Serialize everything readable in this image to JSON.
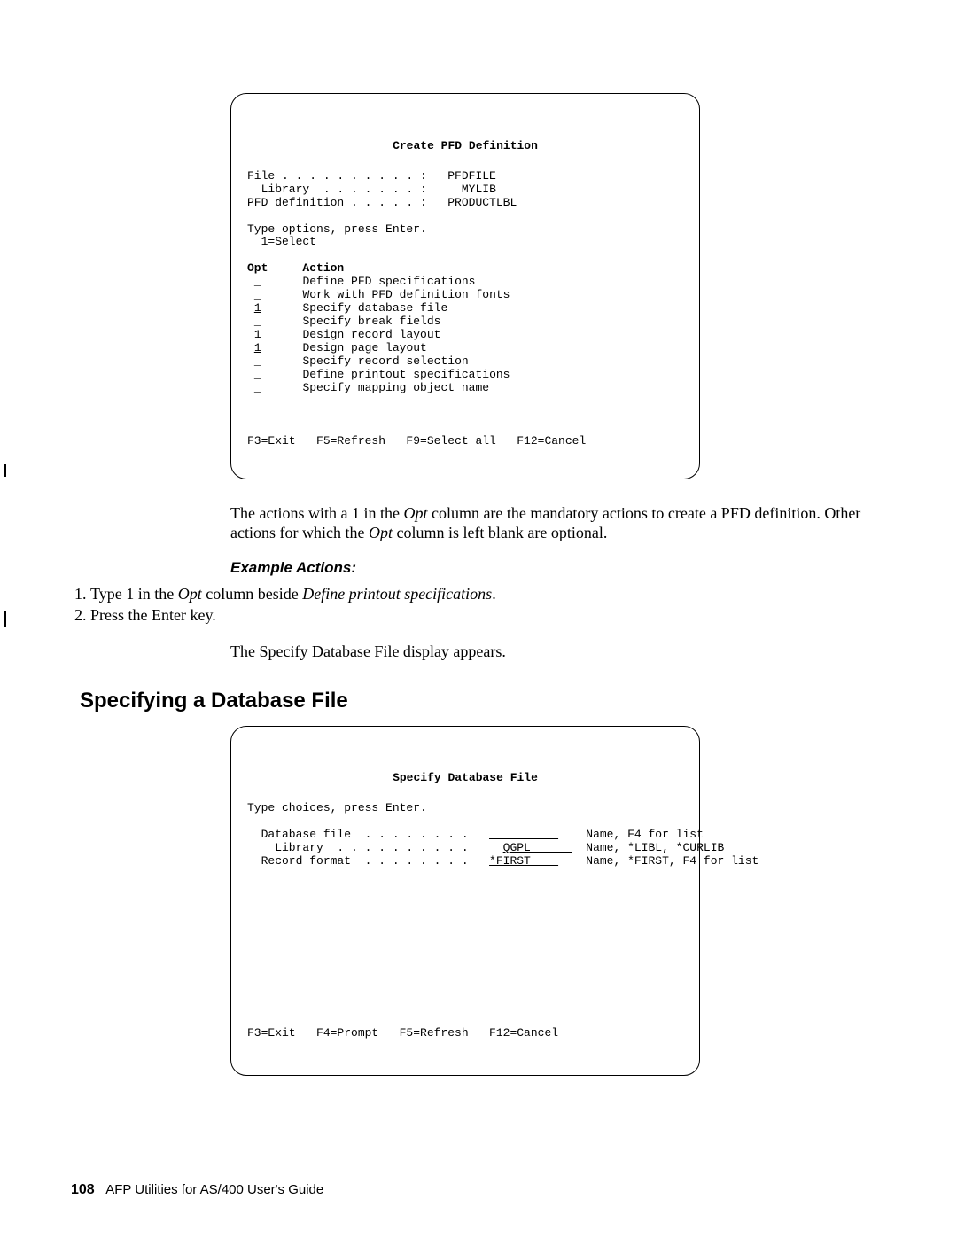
{
  "screen1": {
    "title": "Create PFD Definition",
    "fields": {
      "fileLabel": "File . . . . . . . . . . :",
      "fileValue": "PFDFILE",
      "libraryLabel": "  Library  . . . . . . . :",
      "libraryValue": "MYLIB",
      "pfdDefLabel": "PFD definition . . . . . :",
      "pfdDefValue": "PRODUCTLBL"
    },
    "instruction1": "Type options, press Enter.",
    "instruction2": "  1=Select",
    "cols": {
      "opt": "Opt",
      "action": "Action"
    },
    "rows": [
      {
        "opt": "_",
        "opt_u": false,
        "action": "Define PFD specifications"
      },
      {
        "opt": "_",
        "opt_u": false,
        "action": "Work with PFD definition fonts"
      },
      {
        "opt": "1",
        "opt_u": true,
        "action": "Specify database file"
      },
      {
        "opt": "_",
        "opt_u": false,
        "action": "Specify break fields"
      },
      {
        "opt": "1",
        "opt_u": true,
        "action": "Design record layout"
      },
      {
        "opt": "1",
        "opt_u": true,
        "action": "Design page layout"
      },
      {
        "opt": "_",
        "opt_u": false,
        "action": "Specify record selection"
      },
      {
        "opt": "_",
        "opt_u": false,
        "action": "Define printout specifications"
      },
      {
        "opt": "_",
        "opt_u": false,
        "action": "Specify mapping object name"
      }
    ],
    "fkeys": "F3=Exit   F5=Refresh   F9=Select all   F12=Cancel"
  },
  "para1a": "The actions with a 1 in the ",
  "para1b": "Opt",
  "para1c": " column are the mandatory actions to create a PFD definition.  Other actions for which the ",
  "para1d": "Opt",
  "para1e": " column is left blank are optional.",
  "exampleHead": "Example Actions:",
  "steps": {
    "s1a": "Type 1 in the ",
    "s1b": "Opt",
    "s1c": " column beside ",
    "s1d": "Define printout specifications",
    "s1e": ".",
    "s2": "Press the Enter key."
  },
  "para2": "The Specify Database File display appears.",
  "sectionHead": "Specifying a Database File",
  "screen2": {
    "title": "Specify Database File",
    "instruction": "Type choices, press Enter.",
    "rows": [
      {
        "label": "  Database file  . . . . . . . .",
        "value": "          ",
        "u": true,
        "hint": "Name, F4 for list"
      },
      {
        "label": "    Library  . . . . . . . . . .",
        "value": "QGPL      ",
        "u": true,
        "hint": "Name, *LIBL, *CURLIB"
      },
      {
        "label": "  Record format  . . . . . . . .",
        "value": "*FIRST    ",
        "u": true,
        "hint": "Name, *FIRST, F4 for list"
      }
    ],
    "fkeys": "F3=Exit   F4=Prompt   F5=Refresh   F12=Cancel"
  },
  "footer": {
    "page": "108",
    "title": "AFP Utilities for AS/400 User's Guide"
  }
}
